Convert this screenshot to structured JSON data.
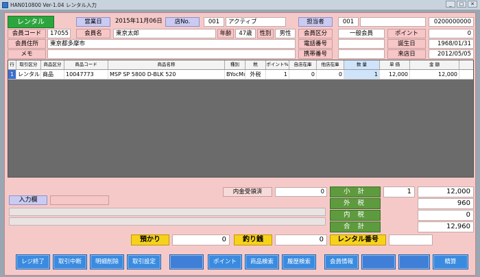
{
  "window": {
    "title": "HAN010800 Ver-1.04 レンタル入力"
  },
  "header": {
    "mode": "レンタル",
    "business_day_label": "営業日",
    "business_day": "2015年11月06日",
    "store_label": "店No.",
    "store_no": "001",
    "store_name": "アクティブ",
    "staff_label": "担当者",
    "staff_no": "001",
    "receipt_no": "0200000000"
  },
  "member": {
    "code_label": "会員コード",
    "code": "17055",
    "name_label": "会員名",
    "name": "東京太郎",
    "age_label": "年齢",
    "age": "47歳",
    "sex_label": "性別",
    "sex": "男性",
    "class_label": "会員区分",
    "class": "一般会員",
    "point_label": "ポイント",
    "point": "0",
    "address_label": "会員住所",
    "address": "東京都多摩市",
    "phone_label": "電話番号",
    "birthday_label": "誕生日",
    "birthday": "1968/01/31",
    "memo_label": "メモ",
    "mobile_label": "携帯番号",
    "last_visit_label": "来店日",
    "last_visit": "2012/05/05"
  },
  "grid": {
    "headers": [
      "行",
      "取引区分",
      "商品区分",
      "商品コード",
      "商品名称",
      "種別",
      "税",
      "ポイント%",
      "自店在庫",
      "他店在庫",
      "数 量",
      "単 価",
      "金 額"
    ],
    "rows": [
      [
        "1",
        "レンタル",
        "商品",
        "10047773",
        "MSP SP 5800 D-BLK 520",
        "BYocMu",
        "外税",
        "1",
        "0",
        "0",
        "1",
        "12,000",
        "12,000"
      ]
    ]
  },
  "lower": {
    "input_mode_label": "入力欄",
    "deposit_label": "内金受領済",
    "deposit_value": "0",
    "subtotal_label": "小 計",
    "subtotal_qty": "1",
    "subtotal": "12,000",
    "outer_tax_label": "外 税",
    "outer_tax": "960",
    "inner_tax_label": "内 税",
    "inner_tax": "0",
    "total_label": "合 計",
    "total": "12,960",
    "received_label": "預かり",
    "received": "0",
    "change_label": "釣り銭",
    "change": "0",
    "rental_no_label": "レンタル番号"
  },
  "buttons": {
    "reg_end": "レジ終了",
    "suspend": "取引中断",
    "delete_line": "明細削除",
    "settings": "取引設定",
    "point": "ポイント",
    "product_search": "商品検索",
    "history_search": "履歴検索",
    "member_info": "会員情報",
    "checkout": "精算"
  },
  "colors": {
    "background": "#f6c9c9",
    "accent_green": "#2da53e",
    "button_blue": "#3a8be0",
    "yellow": "#f7d21b"
  }
}
